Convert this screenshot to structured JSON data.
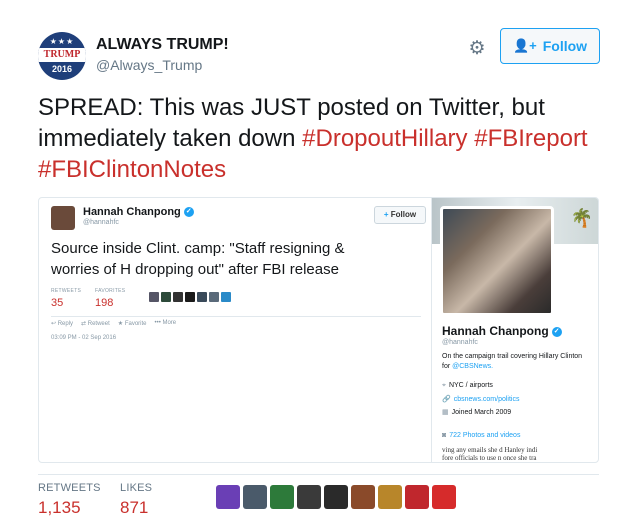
{
  "author": {
    "name": "ALWAYS TRUMP!",
    "handle": "@Always_Trump",
    "avatar_text": "TRUMP",
    "avatar_year": "2016"
  },
  "header": {
    "follow_label": "Follow"
  },
  "tweet": {
    "text": "SPREAD:  This was JUST posted on Twitter, but immediately taken down",
    "hashtags": [
      "#DropoutHillary",
      "#FBIreport",
      "#FBIClintonNotes"
    ]
  },
  "embedded": {
    "name": "Hannah Chanpong",
    "handle": "@hannahfc",
    "follow_label": "Follow",
    "text": "Source inside Clint. camp: \"Staff resigning & worries of H dropping out\" after FBI release",
    "retweets_label": "RETWEETS",
    "retweets": "35",
    "favorites_label": "FAVORITES",
    "favorites": "198",
    "actions": [
      "Reply",
      "Retweet",
      "Favorite",
      "More"
    ],
    "time": "03:09 PM - 02 Sep 2016"
  },
  "profile_card": {
    "name": "Hannah Chanpong",
    "handle": "@hannahfc",
    "bio_prefix": "On the campaign trail covering Hillary Clinton for",
    "bio_link": "@CBSNews.",
    "location": "NYC / airports",
    "website": "cbsnews.com/politics",
    "joined": "Joined March 2009",
    "photos": "722 Photos and videos",
    "noise_line_1": "ving any emails she  d Hanley indi",
    "noise_line_2": "fore officials to use  n once she tra"
  },
  "footer": {
    "retweets_label": "RETWEETS",
    "retweets": "1,135",
    "likes_label": "LIKES",
    "likes": "871",
    "liker_colors": [
      "#6a3fb5",
      "#4a5a6a",
      "#2d7a3a",
      "#3a3a3a",
      "#2a2a2a",
      "#8a4a2a",
      "#b8862a",
      "#c0272d",
      "#d62b2b"
    ]
  },
  "colors": {
    "accent": "#1da1f2",
    "hashtag": "#c9302c",
    "count": "#c9302c"
  }
}
